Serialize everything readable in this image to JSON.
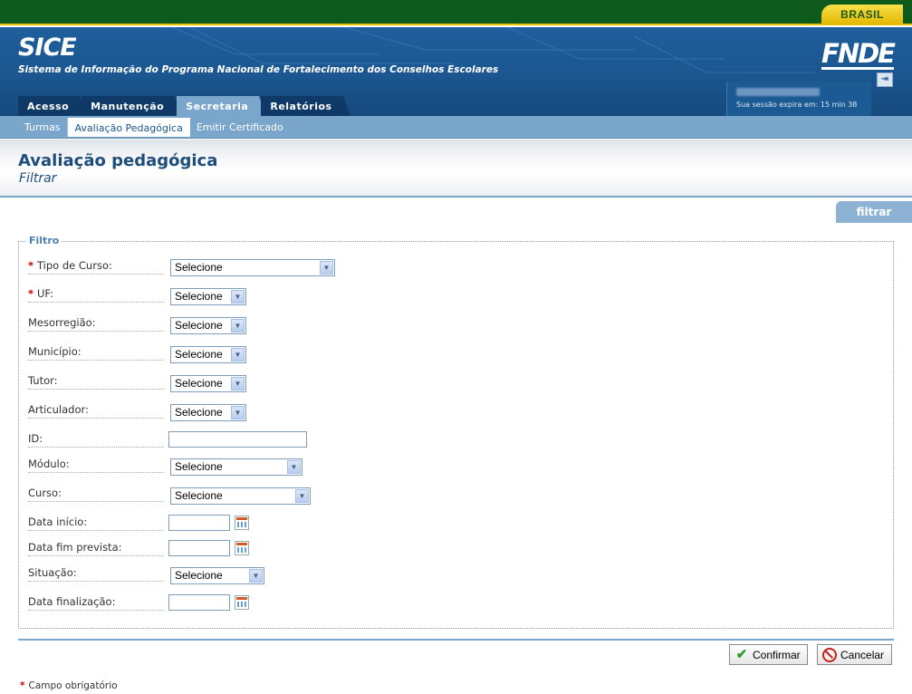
{
  "gov_bar": {
    "badge": "BRASIL"
  },
  "header": {
    "app_title": "SICE",
    "app_subtitle": "Sistema de Informação do Programa Nacional de Fortalecimento dos Conselhos Escolares",
    "logo": "FNDE",
    "session_expire": "Sua sessão expira em: 15 min 38",
    "logout_icon": "logout-icon"
  },
  "tabs": [
    {
      "label": "Acesso",
      "active": false
    },
    {
      "label": "Manutenção",
      "active": false
    },
    {
      "label": "Secretaria",
      "active": true
    },
    {
      "label": "Relatórios",
      "active": false
    }
  ],
  "submenu": [
    {
      "label": "Turmas",
      "active": false
    },
    {
      "label": "Avaliação Pedagógica",
      "active": true
    },
    {
      "label": "Emitir Certificado",
      "active": false
    }
  ],
  "page": {
    "title": "Avaliação pedagógica",
    "subtitle": "Filtrar",
    "filter_tab": "filtrar"
  },
  "form": {
    "legend": "Filtro",
    "required_mark": "*",
    "fields": {
      "tipo_curso": {
        "label": "Tipo de Curso:",
        "value": "Selecione",
        "required": true
      },
      "uf": {
        "label": "UF:",
        "value": "Selecione",
        "required": true
      },
      "mesorregiao": {
        "label": "Mesorregião:",
        "value": "Selecione"
      },
      "municipio": {
        "label": "Município:",
        "value": "Selecione"
      },
      "tutor": {
        "label": "Tutor:",
        "value": "Selecione"
      },
      "articulador": {
        "label": "Articulador:",
        "value": "Selecione"
      },
      "id": {
        "label": "ID:",
        "value": ""
      },
      "modulo": {
        "label": "Módulo:",
        "value": "Selecione"
      },
      "curso": {
        "label": "Curso:",
        "value": "Selecione"
      },
      "data_inicio": {
        "label": "Data início:",
        "value": ""
      },
      "data_fim_prevista": {
        "label": "Data fim prevista:",
        "value": ""
      },
      "situacao": {
        "label": "Situação:",
        "value": "Selecione"
      },
      "data_finalizacao": {
        "label": "Data finalização:",
        "value": ""
      }
    }
  },
  "buttons": {
    "confirm": "Confirmar",
    "cancel": "Cancelar"
  },
  "footnote": {
    "mark": "*",
    "text": "Campo obrigatório"
  }
}
